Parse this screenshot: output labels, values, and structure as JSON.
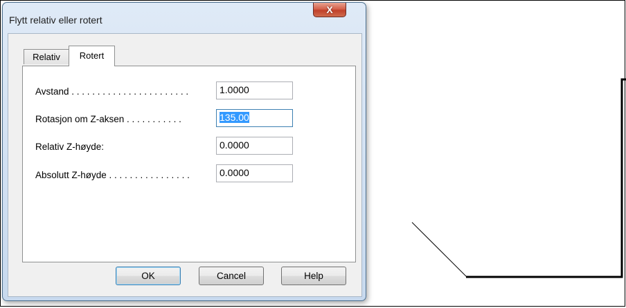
{
  "window": {
    "title": "Flytt relativ eller rotert",
    "close_glyph": "X"
  },
  "tabs": [
    {
      "label": "Relativ",
      "active": false
    },
    {
      "label": "Rotert",
      "active": true
    }
  ],
  "fields": [
    {
      "label": "Avstand . . . . . . . . . . . . . . . . . . . . . . .",
      "value": "1.0000"
    },
    {
      "label": "Rotasjon om Z-aksen . . . . . . . . . . .",
      "value": "135.00",
      "selected": true
    },
    {
      "label": "Relativ Z-høyde:",
      "value": "0.0000"
    },
    {
      "label": "Absolutt Z-høyde . . . . . . . . . . . . . . . .",
      "value": "0.0000"
    }
  ],
  "buttons": {
    "ok": "OK",
    "cancel": "Cancel",
    "help": "Help"
  },
  "colors": {
    "selection": "#3399ff",
    "focus_border": "#3c7fb1",
    "close_button": "#c7432d"
  },
  "icons": {
    "close": "close-icon"
  }
}
